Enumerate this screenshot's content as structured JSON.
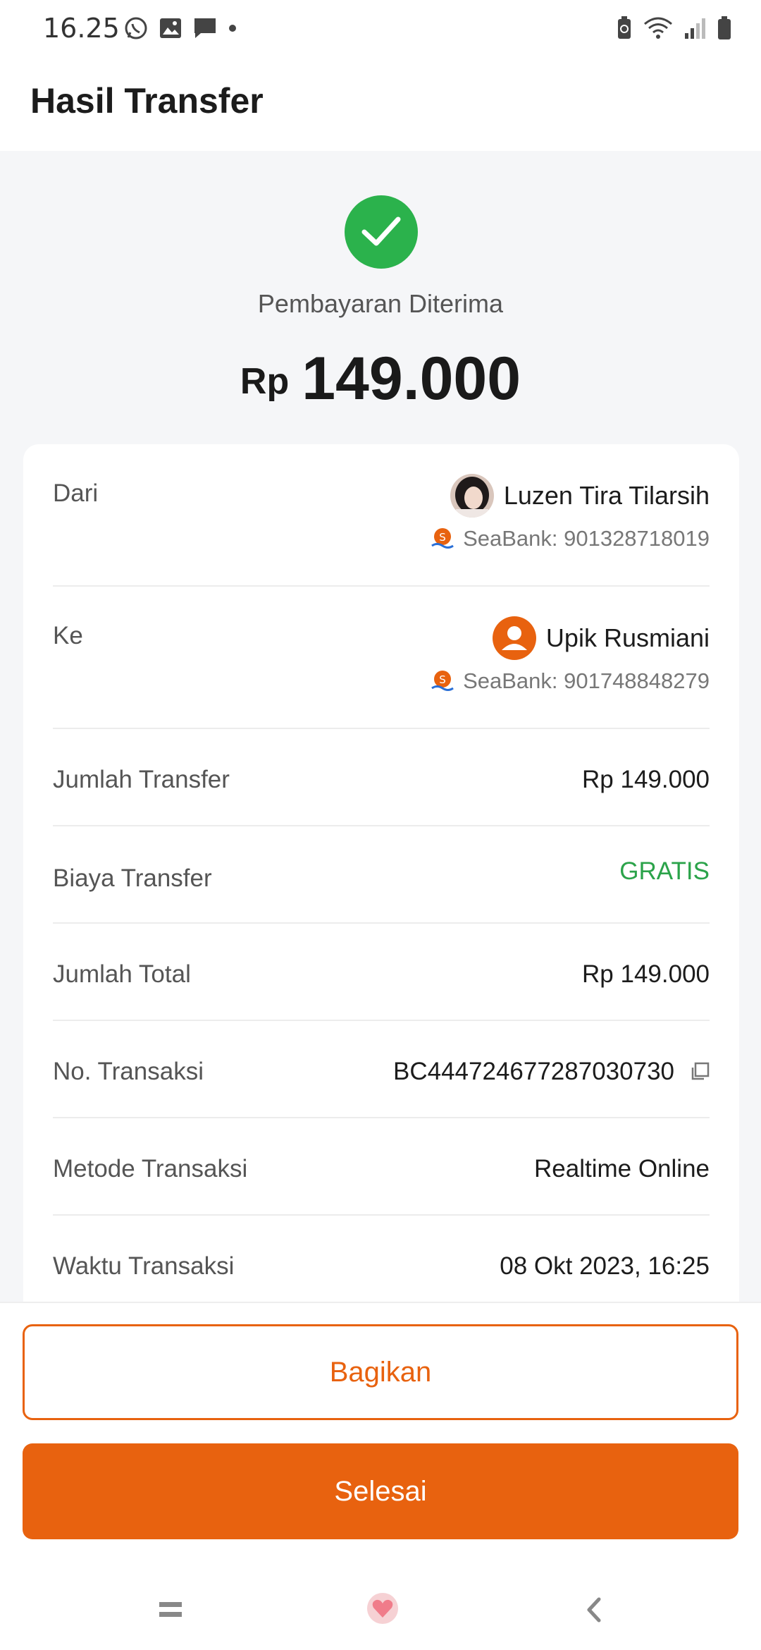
{
  "status_bar": {
    "time": "16.25",
    "left_icons": [
      "whatsapp-icon",
      "gallery-icon",
      "message-icon",
      "dot-icon"
    ],
    "right_icons": [
      "battery-saver-icon",
      "wifi-icon",
      "signal-icon",
      "battery-icon"
    ]
  },
  "header": {
    "title": "Hasil Transfer"
  },
  "result": {
    "status_text": "Pembayaran Diterima",
    "currency": "Rp",
    "amount": "149.000",
    "accent_color": "#2bb24c"
  },
  "details": {
    "from": {
      "label": "Dari",
      "name": "Luzen Tira Tilarsih",
      "bank": "SeaBank: 901328718019"
    },
    "to": {
      "label": "Ke",
      "name": "Upik Rusmiani",
      "bank": "SeaBank: 901748848279"
    },
    "rows": [
      {
        "label": "Jumlah Transfer",
        "value": "Rp 149.000"
      },
      {
        "label": "Biaya Transfer",
        "value": "GRATIS"
      },
      {
        "label": "Jumlah Total",
        "value": "Rp 149.000"
      },
      {
        "label": "No. Transaksi",
        "value": "BC444724677287030730"
      },
      {
        "label": "Metode Transaksi",
        "value": "Realtime Online"
      },
      {
        "label": "Waktu Transaksi",
        "value": "08 Okt 2023, 16:25"
      }
    ]
  },
  "buttons": {
    "share": "Bagikan",
    "done": "Selesai",
    "brand_color": "#e8620f"
  },
  "nav": {
    "icons": [
      "recent-apps-icon",
      "home-icon",
      "back-icon"
    ]
  }
}
